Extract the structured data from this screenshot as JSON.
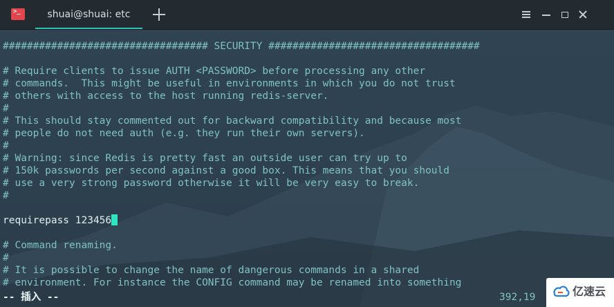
{
  "window": {
    "tab_title": "shuai@shuai: etc"
  },
  "icons": {
    "app": "terminal-icon",
    "new_tab": "plus-icon",
    "menu": "hamburger-menu-icon",
    "minimize": "minimize-icon",
    "maximize": "maximize-icon",
    "close": "close-icon"
  },
  "colors": {
    "accent": "#2ec4b6",
    "comment_text": "#7fc3c3",
    "code_text": "#e2eef0",
    "cursor": "#2ee6c4"
  },
  "editor": {
    "lines": [
      "################################## SECURITY ###################################",
      "",
      "# Require clients to issue AUTH <PASSWORD> before processing any other",
      "# commands.  This might be useful in environments in which you do not trust",
      "# others with access to the host running redis-server.",
      "#",
      "# This should stay commented out for backward compatibility and because most",
      "# people do not need auth (e.g. they run their own servers).",
      "#",
      "# Warning: since Redis is pretty fast an outside user can try up to",
      "# 150k passwords per second against a good box. This means that you should",
      "# use a very strong password otherwise it will be very easy to break.",
      "#",
      "",
      "requirepass 123456",
      "",
      "# Command renaming.",
      "#",
      "# It is possible to change the name of dangerous commands in a shared",
      "# environment. For instance the CONFIG command may be renamed into something"
    ],
    "code_line_index": 14,
    "cursor_after_line": 14
  },
  "status": {
    "mode": "-- 插入 --",
    "position": "392,19"
  },
  "watermark": {
    "text": "亿速云"
  }
}
